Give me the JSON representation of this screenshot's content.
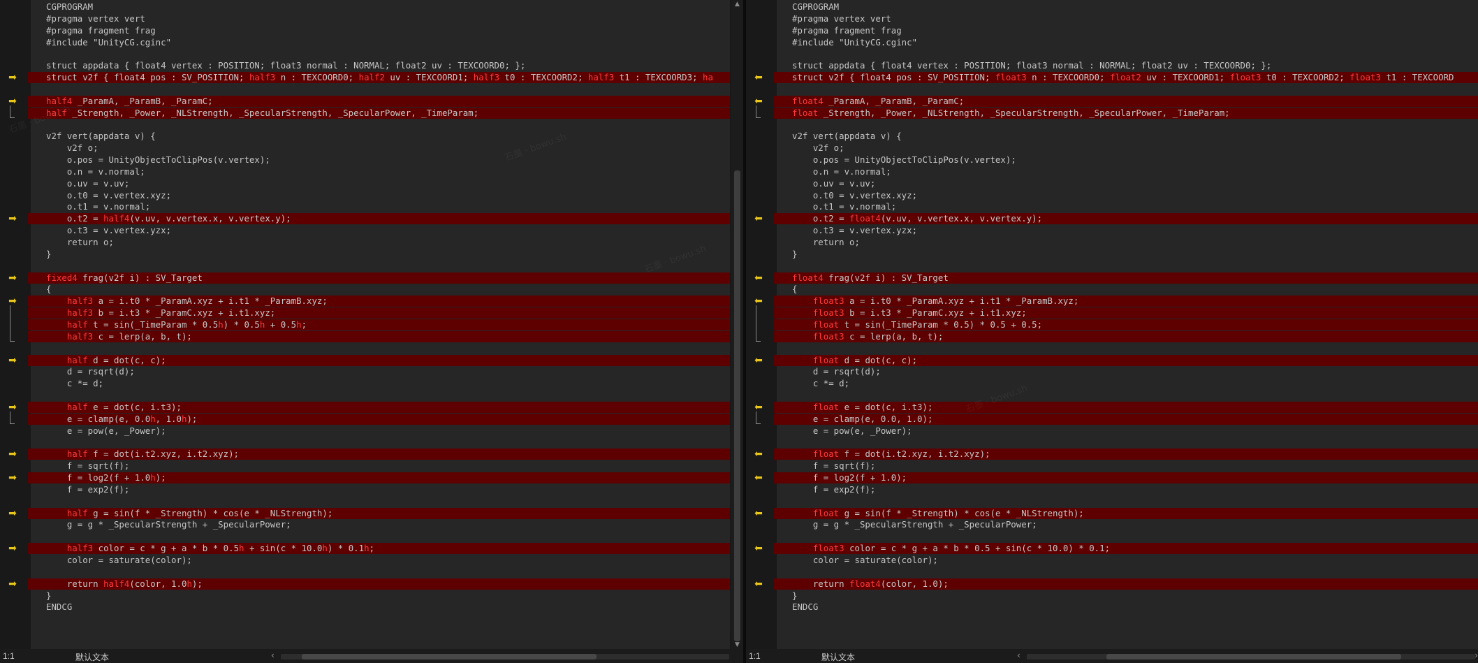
{
  "left": {
    "status": {
      "position": "1:1",
      "encoding": "默认文本"
    },
    "lines": [
      {
        "segments": [
          {
            "t": "CGPROGRAM"
          }
        ]
      },
      {
        "segments": [
          {
            "t": "#pragma vertex vert"
          }
        ]
      },
      {
        "segments": [
          {
            "t": "#pragma fragment frag"
          }
        ]
      },
      {
        "segments": [
          {
            "t": "#include \"UnityCG.cginc\""
          }
        ]
      },
      {
        "segments": [
          {
            "t": ""
          }
        ]
      },
      {
        "segments": [
          {
            "t": "struct appdata { float4 vertex : POSITION; float3 normal : NORMAL; float2 uv : TEXCOORD0; };"
          }
        ]
      },
      {
        "diff": true,
        "marker": "arrow-right",
        "segments": [
          {
            "t": "struct v2f { float4 pos : SV_POSITION; "
          },
          {
            "t": "half3",
            "h": true
          },
          {
            "t": " n : TEXCOORD0; "
          },
          {
            "t": "half2",
            "h": true
          },
          {
            "t": " uv : TEXCOORD1; "
          },
          {
            "t": "half3",
            "h": true
          },
          {
            "t": " t0 : TEXCOORD2; "
          },
          {
            "t": "half3",
            "h": true
          },
          {
            "t": " t1 : TEXCOORD3; "
          },
          {
            "t": "ha",
            "h": true
          }
        ]
      },
      {
        "segments": [
          {
            "t": ""
          }
        ]
      },
      {
        "diff": true,
        "marker": "arrow-right",
        "segments": [
          {
            "t": "half4",
            "h": true
          },
          {
            "t": " _ParamA, _ParamB, _ParamC;"
          }
        ]
      },
      {
        "diff": true,
        "segments": [
          {
            "t": "half",
            "h": true
          },
          {
            "t": " _Strength, _Power, _NLStrength, _SpecularStrength, _SpecularPower, _TimeParam;"
          }
        ]
      },
      {
        "segments": [
          {
            "t": ""
          }
        ]
      },
      {
        "segments": [
          {
            "t": "v2f vert(appdata v) {"
          }
        ]
      },
      {
        "segments": [
          {
            "t": "    v2f o;"
          }
        ]
      },
      {
        "segments": [
          {
            "t": "    o.pos = UnityObjectToClipPos(v.vertex);"
          }
        ]
      },
      {
        "segments": [
          {
            "t": "    o.n = v.normal;"
          }
        ]
      },
      {
        "segments": [
          {
            "t": "    o.uv = v.uv;"
          }
        ]
      },
      {
        "segments": [
          {
            "t": "    o.t0 = v.vertex.xyz;"
          }
        ]
      },
      {
        "segments": [
          {
            "t": "    o.t1 = v.normal;"
          }
        ]
      },
      {
        "diff": true,
        "marker": "arrow-right",
        "segments": [
          {
            "t": "    o.t2 = "
          },
          {
            "t": "half4",
            "h": true
          },
          {
            "t": "(v.uv, v.vertex.x, v.vertex.y);"
          }
        ]
      },
      {
        "segments": [
          {
            "t": "    o.t3 = v.vertex.yzx;"
          }
        ]
      },
      {
        "segments": [
          {
            "t": "    return o;"
          }
        ]
      },
      {
        "segments": [
          {
            "t": "}"
          }
        ]
      },
      {
        "segments": [
          {
            "t": ""
          }
        ]
      },
      {
        "diff": true,
        "marker": "arrow-right",
        "segments": [
          {
            "t": "fixed4",
            "h": true
          },
          {
            "t": " frag(v2f i) : SV_Target"
          }
        ]
      },
      {
        "segments": [
          {
            "t": "{"
          }
        ]
      },
      {
        "diff": true,
        "marker": "arrow-right",
        "segments": [
          {
            "t": "    "
          },
          {
            "t": "half3",
            "h": true
          },
          {
            "t": " a = i.t0 * _ParamA.xyz + i.t1 * _ParamB.xyz;"
          }
        ]
      },
      {
        "diff": true,
        "segments": [
          {
            "t": "    "
          },
          {
            "t": "half3",
            "h": true
          },
          {
            "t": " b = i.t3 * _ParamC.xyz + i.t1.xyz;"
          }
        ]
      },
      {
        "diff": true,
        "segments": [
          {
            "t": "    "
          },
          {
            "t": "half",
            "h": true
          },
          {
            "t": " t = sin(_TimeParam * 0.5"
          },
          {
            "t": "h",
            "h": true
          },
          {
            "t": ") * 0.5"
          },
          {
            "t": "h",
            "h": true
          },
          {
            "t": " + 0.5"
          },
          {
            "t": "h",
            "h": true
          },
          {
            "t": ";"
          }
        ]
      },
      {
        "diff": true,
        "segments": [
          {
            "t": "    "
          },
          {
            "t": "half3",
            "h": true
          },
          {
            "t": " c = lerp(a, b, t);"
          }
        ]
      },
      {
        "segments": [
          {
            "t": ""
          }
        ]
      },
      {
        "diff": true,
        "marker": "arrow-right",
        "segments": [
          {
            "t": "    "
          },
          {
            "t": "half",
            "h": true
          },
          {
            "t": " d = dot(c, c);"
          }
        ]
      },
      {
        "segments": [
          {
            "t": "    d = rsqrt(d);"
          }
        ]
      },
      {
        "segments": [
          {
            "t": "    c *= d;"
          }
        ]
      },
      {
        "segments": [
          {
            "t": ""
          }
        ]
      },
      {
        "diff": true,
        "marker": "arrow-right",
        "segments": [
          {
            "t": "    "
          },
          {
            "t": "half",
            "h": true
          },
          {
            "t": " e = dot(c, i.t3);"
          }
        ]
      },
      {
        "diff": true,
        "segments": [
          {
            "t": "    e = clamp(e, 0.0"
          },
          {
            "t": "h",
            "h": true
          },
          {
            "t": ", 1.0"
          },
          {
            "t": "h",
            "h": true
          },
          {
            "t": ");"
          }
        ]
      },
      {
        "segments": [
          {
            "t": "    e = pow(e, _Power);"
          }
        ]
      },
      {
        "segments": [
          {
            "t": ""
          }
        ]
      },
      {
        "diff": true,
        "marker": "arrow-right",
        "segments": [
          {
            "t": "    "
          },
          {
            "t": "half",
            "h": true
          },
          {
            "t": " f = dot(i.t2.xyz, i.t2.xyz);"
          }
        ]
      },
      {
        "segments": [
          {
            "t": "    f = sqrt(f);"
          }
        ]
      },
      {
        "diff": true,
        "marker": "arrow-right",
        "segments": [
          {
            "t": "    f = log2(f + 1.0"
          },
          {
            "t": "h",
            "h": true
          },
          {
            "t": ");"
          }
        ]
      },
      {
        "segments": [
          {
            "t": "    f = exp2(f);"
          }
        ]
      },
      {
        "segments": [
          {
            "t": ""
          }
        ]
      },
      {
        "diff": true,
        "marker": "arrow-right",
        "segments": [
          {
            "t": "    "
          },
          {
            "t": "half",
            "h": true
          },
          {
            "t": " g = sin(f * _Strength) * cos(e * _NLStrength);"
          }
        ]
      },
      {
        "segments": [
          {
            "t": "    g = g * _SpecularStrength + _SpecularPower;"
          }
        ]
      },
      {
        "segments": [
          {
            "t": ""
          }
        ]
      },
      {
        "diff": true,
        "marker": "arrow-right",
        "segments": [
          {
            "t": "    "
          },
          {
            "t": "half3",
            "h": true
          },
          {
            "t": " color = c * g + a * b * 0.5"
          },
          {
            "t": "h",
            "h": true
          },
          {
            "t": " + sin(c * 10.0"
          },
          {
            "t": "h",
            "h": true
          },
          {
            "t": ") * 0.1"
          },
          {
            "t": "h",
            "h": true
          },
          {
            "t": ";"
          }
        ]
      },
      {
        "segments": [
          {
            "t": "    color = saturate(color);"
          }
        ]
      },
      {
        "segments": [
          {
            "t": ""
          }
        ]
      },
      {
        "diff": true,
        "marker": "arrow-right",
        "segments": [
          {
            "t": "    return "
          },
          {
            "t": "half4",
            "h": true
          },
          {
            "t": "(color, 1.0"
          },
          {
            "t": "h",
            "h": true
          },
          {
            "t": ");"
          }
        ]
      },
      {
        "segments": [
          {
            "t": "}"
          }
        ]
      },
      {
        "segments": [
          {
            "t": "ENDCG"
          }
        ]
      }
    ]
  },
  "right": {
    "status": {
      "position": "1:1",
      "encoding": "默认文本"
    },
    "lines": [
      {
        "segments": [
          {
            "t": "CGPROGRAM"
          }
        ]
      },
      {
        "segments": [
          {
            "t": "#pragma vertex vert"
          }
        ]
      },
      {
        "segments": [
          {
            "t": "#pragma fragment frag"
          }
        ]
      },
      {
        "segments": [
          {
            "t": "#include \"UnityCG.cginc\""
          }
        ]
      },
      {
        "segments": [
          {
            "t": ""
          }
        ]
      },
      {
        "segments": [
          {
            "t": "struct appdata { float4 vertex : POSITION; float3 normal : NORMAL; float2 uv : TEXCOORD0; };"
          }
        ]
      },
      {
        "diff": true,
        "marker": "arrow-left",
        "segments": [
          {
            "t": "struct v2f { float4 pos : SV_POSITION; "
          },
          {
            "t": "float3",
            "h": true
          },
          {
            "t": " n : TEXCOORD0; "
          },
          {
            "t": "float2",
            "h": true
          },
          {
            "t": " uv : TEXCOORD1; "
          },
          {
            "t": "float3",
            "h": true
          },
          {
            "t": " t0 : TEXCOORD2; "
          },
          {
            "t": "float3",
            "h": true
          },
          {
            "t": " t1 : TEXCOORD"
          }
        ]
      },
      {
        "segments": [
          {
            "t": ""
          }
        ]
      },
      {
        "diff": true,
        "marker": "arrow-left",
        "segments": [
          {
            "t": "float4",
            "h": true
          },
          {
            "t": " _ParamA, _ParamB, _ParamC;"
          }
        ]
      },
      {
        "diff": true,
        "segments": [
          {
            "t": "float",
            "h": true
          },
          {
            "t": " _Strength, _Power, _NLStrength, _SpecularStrength, _SpecularPower, _TimeParam;"
          }
        ]
      },
      {
        "segments": [
          {
            "t": ""
          }
        ]
      },
      {
        "segments": [
          {
            "t": "v2f vert(appdata v) {"
          }
        ]
      },
      {
        "segments": [
          {
            "t": "    v2f o;"
          }
        ]
      },
      {
        "segments": [
          {
            "t": "    o.pos = UnityObjectToClipPos(v.vertex);"
          }
        ]
      },
      {
        "segments": [
          {
            "t": "    o.n = v.normal;"
          }
        ]
      },
      {
        "segments": [
          {
            "t": "    o.uv = v.uv;"
          }
        ]
      },
      {
        "segments": [
          {
            "t": "    o.t0 = v.vertex.xyz;"
          }
        ]
      },
      {
        "segments": [
          {
            "t": "    o.t1 = v.normal;"
          }
        ]
      },
      {
        "diff": true,
        "marker": "arrow-left",
        "segments": [
          {
            "t": "    o.t2 = "
          },
          {
            "t": "float4",
            "h": true
          },
          {
            "t": "(v.uv, v.vertex.x, v.vertex.y);"
          }
        ]
      },
      {
        "segments": [
          {
            "t": "    o.t3 = v.vertex.yzx;"
          }
        ]
      },
      {
        "segments": [
          {
            "t": "    return o;"
          }
        ]
      },
      {
        "segments": [
          {
            "t": "}"
          }
        ]
      },
      {
        "segments": [
          {
            "t": ""
          }
        ]
      },
      {
        "diff": true,
        "marker": "arrow-left",
        "segments": [
          {
            "t": "float4",
            "h": true
          },
          {
            "t": " frag(v2f i) : SV_Target"
          }
        ]
      },
      {
        "segments": [
          {
            "t": "{"
          }
        ]
      },
      {
        "diff": true,
        "marker": "arrow-left",
        "segments": [
          {
            "t": "    "
          },
          {
            "t": "float3",
            "h": true
          },
          {
            "t": " a = i.t0 * _ParamA.xyz + i.t1 * _ParamB.xyz;"
          }
        ]
      },
      {
        "diff": true,
        "segments": [
          {
            "t": "    "
          },
          {
            "t": "float3",
            "h": true
          },
          {
            "t": " b = i.t3 * _ParamC.xyz + i.t1.xyz;"
          }
        ]
      },
      {
        "diff": true,
        "segments": [
          {
            "t": "    "
          },
          {
            "t": "float",
            "h": true
          },
          {
            "t": " t = sin(_TimeParam * 0.5) * 0.5 + 0.5;"
          }
        ]
      },
      {
        "diff": true,
        "segments": [
          {
            "t": "    "
          },
          {
            "t": "float3",
            "h": true
          },
          {
            "t": " c = lerp(a, b, t);"
          }
        ]
      },
      {
        "segments": [
          {
            "t": ""
          }
        ]
      },
      {
        "diff": true,
        "marker": "arrow-left",
        "segments": [
          {
            "t": "    "
          },
          {
            "t": "float",
            "h": true
          },
          {
            "t": " d = dot(c, c);"
          }
        ]
      },
      {
        "segments": [
          {
            "t": "    d = rsqrt(d);"
          }
        ]
      },
      {
        "segments": [
          {
            "t": "    c *= d;"
          }
        ]
      },
      {
        "segments": [
          {
            "t": ""
          }
        ]
      },
      {
        "diff": true,
        "marker": "arrow-left",
        "segments": [
          {
            "t": "    "
          },
          {
            "t": "float",
            "h": true
          },
          {
            "t": " e = dot(c, i.t3);"
          }
        ]
      },
      {
        "diff": true,
        "segments": [
          {
            "t": "    e = clamp(e, 0.0, 1.0);"
          }
        ]
      },
      {
        "segments": [
          {
            "t": "    e = pow(e, _Power);"
          }
        ]
      },
      {
        "segments": [
          {
            "t": ""
          }
        ]
      },
      {
        "diff": true,
        "marker": "arrow-left",
        "segments": [
          {
            "t": "    "
          },
          {
            "t": "float",
            "h": true
          },
          {
            "t": " f = dot(i.t2.xyz, i.t2.xyz);"
          }
        ]
      },
      {
        "segments": [
          {
            "t": "    f = sqrt(f);"
          }
        ]
      },
      {
        "diff": true,
        "marker": "arrow-left",
        "segments": [
          {
            "t": "    f = log2(f + 1.0);"
          }
        ]
      },
      {
        "segments": [
          {
            "t": "    f = exp2(f);"
          }
        ]
      },
      {
        "segments": [
          {
            "t": ""
          }
        ]
      },
      {
        "diff": true,
        "marker": "arrow-left",
        "segments": [
          {
            "t": "    "
          },
          {
            "t": "float",
            "h": true
          },
          {
            "t": " g = sin(f * _Strength) * cos(e * _NLStrength);"
          }
        ]
      },
      {
        "segments": [
          {
            "t": "    g = g * _SpecularStrength + _SpecularPower;"
          }
        ]
      },
      {
        "segments": [
          {
            "t": ""
          }
        ]
      },
      {
        "diff": true,
        "marker": "arrow-left",
        "segments": [
          {
            "t": "    "
          },
          {
            "t": "float3",
            "h": true
          },
          {
            "t": " color = c * g + a * b * 0.5 + sin(c * 10.0) * 0.1;"
          }
        ]
      },
      {
        "segments": [
          {
            "t": "    color = saturate(color);"
          }
        ]
      },
      {
        "segments": [
          {
            "t": ""
          }
        ]
      },
      {
        "diff": true,
        "marker": "arrow-left",
        "segments": [
          {
            "t": "    return "
          },
          {
            "t": "float4",
            "h": true
          },
          {
            "t": "(color, 1.0);"
          }
        ]
      },
      {
        "segments": [
          {
            "t": "}"
          }
        ]
      },
      {
        "segments": [
          {
            "t": "ENDCG"
          }
        ]
      }
    ]
  },
  "colors": {
    "diff_background": "#5e0000",
    "diff_token": "#ff3a3a",
    "marker": "#e8c61a",
    "editor_background": "#262626",
    "text": "#c6c6c6"
  },
  "icons": {
    "arrow-right": "➡",
    "arrow-left": "⬅",
    "scroll-left": "‹",
    "scroll-right": "›",
    "scroll-up": "▲",
    "scroll-down": "▼"
  }
}
